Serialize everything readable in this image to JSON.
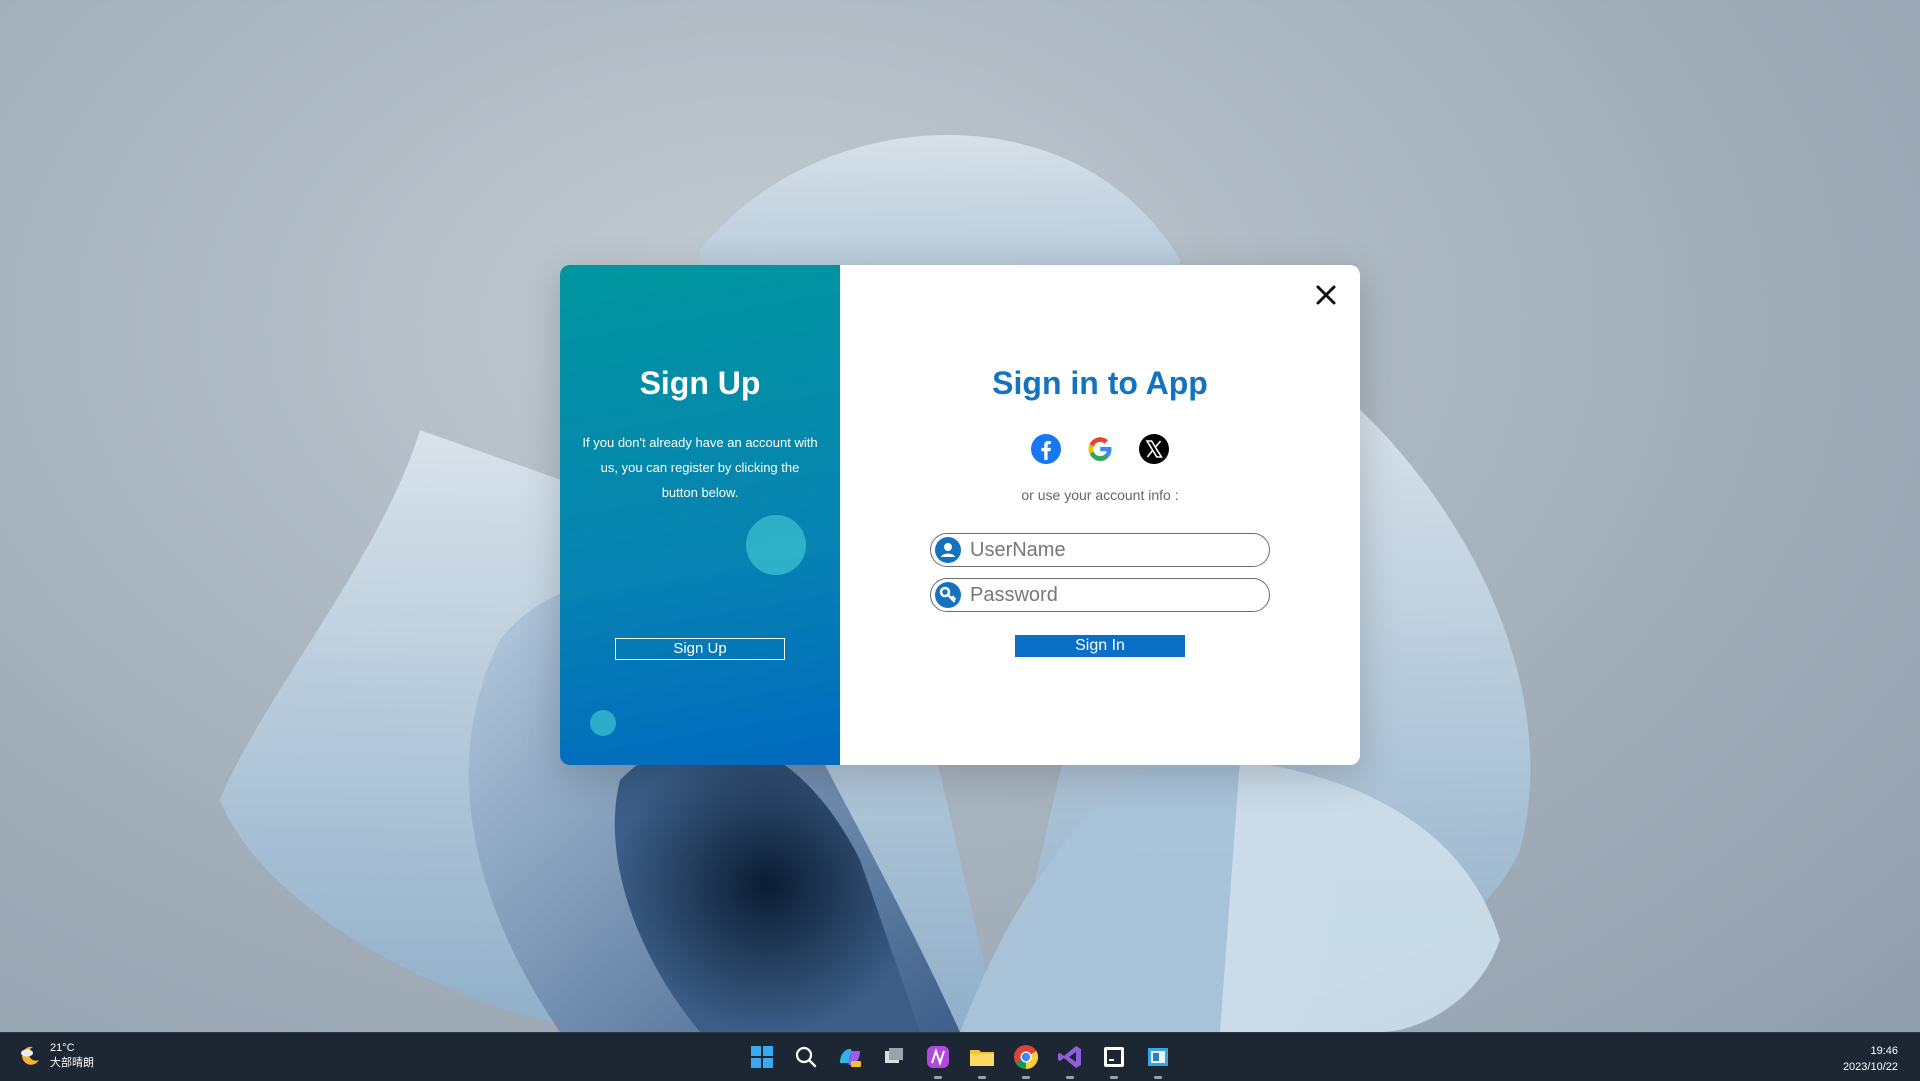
{
  "left_panel": {
    "title": "Sign Up",
    "description": "If you don't already have an account with us, you can register by clicking the button below.",
    "button_label": "Sign Up"
  },
  "right_panel": {
    "title": "Sign in to App",
    "social_icons": [
      "facebook-icon",
      "google-icon",
      "x-icon"
    ],
    "or_text": "or use your account info :",
    "username_placeholder": "UserName",
    "password_placeholder": "Password",
    "signin_label": "Sign In"
  },
  "colors": {
    "accent": "#1473c1",
    "panel_gradient_start": "#00969f",
    "panel_gradient_end": "#0069bf"
  },
  "taskbar": {
    "weather_temp": "21°C",
    "weather_desc": "大部晴朗",
    "time": "19:46",
    "date": "2023/10/22",
    "apps": [
      "start-icon",
      "search-icon",
      "copilot-icon",
      "task-view-icon",
      "app-purple-icon",
      "file-explorer-icon",
      "chrome-icon",
      "visual-studio-icon",
      "terminal-icon",
      "app-window-icon"
    ]
  }
}
